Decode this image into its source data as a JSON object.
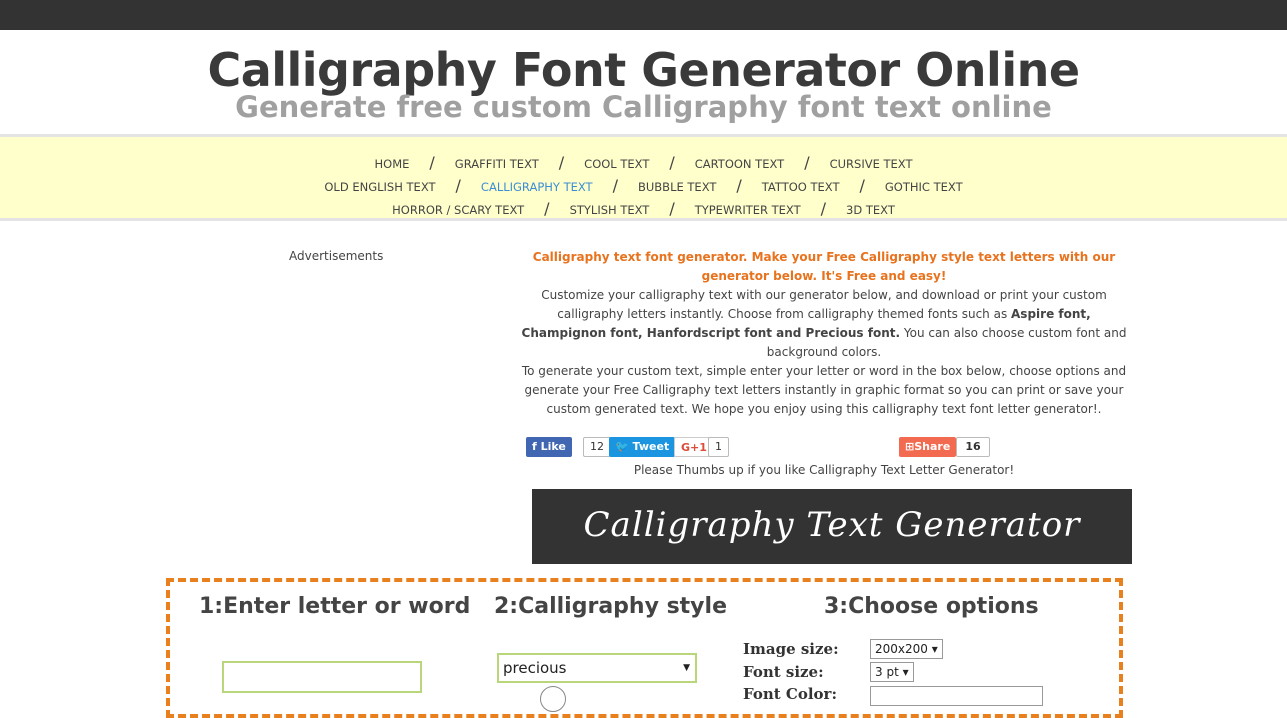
{
  "header": {
    "title": "Calligraphy Font Generator Online",
    "subtitle": "Generate free custom Calligraphy font text online"
  },
  "nav": {
    "rows": [
      [
        "HOME",
        "GRAFFITI TEXT",
        "COOL TEXT",
        "CARTOON TEXT",
        "CURSIVE TEXT"
      ],
      [
        "OLD ENGLISH TEXT",
        "CALLIGRAPHY TEXT",
        "BUBBLE TEXT",
        "TATTOO TEXT",
        "GOTHIC TEXT"
      ],
      [
        "HORROR / SCARY TEXT",
        "STYLISH TEXT",
        "TYPEWRITER TEXT",
        "3D TEXT"
      ]
    ],
    "active": "CALLIGRAPHY TEXT",
    "separator": "/"
  },
  "ads_label": "Advertisements",
  "intro": {
    "lead": "Calligraphy text font generator. Make your Free Calligraphy style text letters with our generator below. It's Free and easy!",
    "p1_a": "Customize your calligraphy text with our generator below, and download or print your custom calligraphy letters instantly. Choose from calligraphy themed fonts such as ",
    "p1_bold": "Aspire font, Champignon font, Hanfordscript font and Precious font.",
    "p1_b": " You can also choose custom font and background colors.",
    "p2": "To generate your custom text, simple enter your letter or word in the box below, choose options and generate your Free Calligraphy text letters instantly in graphic format so you can print or save your custom generated text. We hope you enjoy using this calligraphy text font letter generator!."
  },
  "social": {
    "like": "Like",
    "like_count": "12",
    "tweet": "Tweet",
    "gplus": "G+1",
    "gplus_count": "1",
    "share": "Share",
    "share_count": "16",
    "colors": {
      "facebook": "#4267b2",
      "twitter": "#1b95e0",
      "gplus": "#dd4b39",
      "share": "#f26b50"
    }
  },
  "thumbs": "Please Thumbs up if you like Calligraphy Text Letter Generator!",
  "banner": "Calligraphy Text Generator",
  "form": {
    "step1": "1:Enter letter or word",
    "step2": "2:Calligraphy style",
    "step3": "3:Choose options",
    "text_value": "",
    "style_value": "precious",
    "image_size_label": "Image size:",
    "image_size_value": "200x200",
    "font_size_label": "Font size:",
    "font_size_value": "3 pt",
    "font_color_label": "Font Color:"
  },
  "accent": "#e8801e"
}
